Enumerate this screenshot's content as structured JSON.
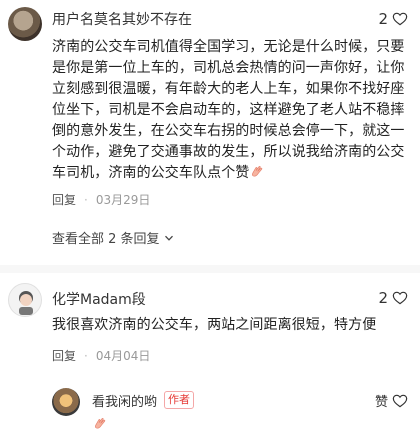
{
  "comment1": {
    "username": "用户名莫名其妙不存在",
    "likes": "2",
    "text": "济南的公交车司机值得全国学习，无论是什么时候，只要是你是第一位上车的，司机总会热情的问一声你好，让你立刻感到很温暖，有年龄大的老人上车，如果你不找好座位坐下，司机是不会启动车的，这样避免了老人站不稳摔倒的意外发生，在公交车右拐的时候总会停一下，就这一个动作，避免了交通事故的发生，所以说我给济南的公交车司机，济南的公交车队点个赞",
    "reply_label": "回复",
    "separator": "·",
    "date": "03月29日",
    "view_all": "查看全部 2 条回复"
  },
  "comment2": {
    "username": "化学Madam段",
    "likes": "2",
    "text": "我很喜欢济南的公交车，两站之间距离很短，特方便",
    "reply_label": "回复",
    "separator": "·",
    "date": "04月04日"
  },
  "reply": {
    "username": "看我闲的哟",
    "badge": "作者",
    "like_label": "赞"
  },
  "colors": {
    "accent_red": "#e53935",
    "text_main": "#222222",
    "text_meta": "#999999",
    "divider": "#f7f7f7"
  },
  "icons": [
    "heart-outline-icon",
    "chevron-down-icon",
    "clap-emoji-icon"
  ]
}
